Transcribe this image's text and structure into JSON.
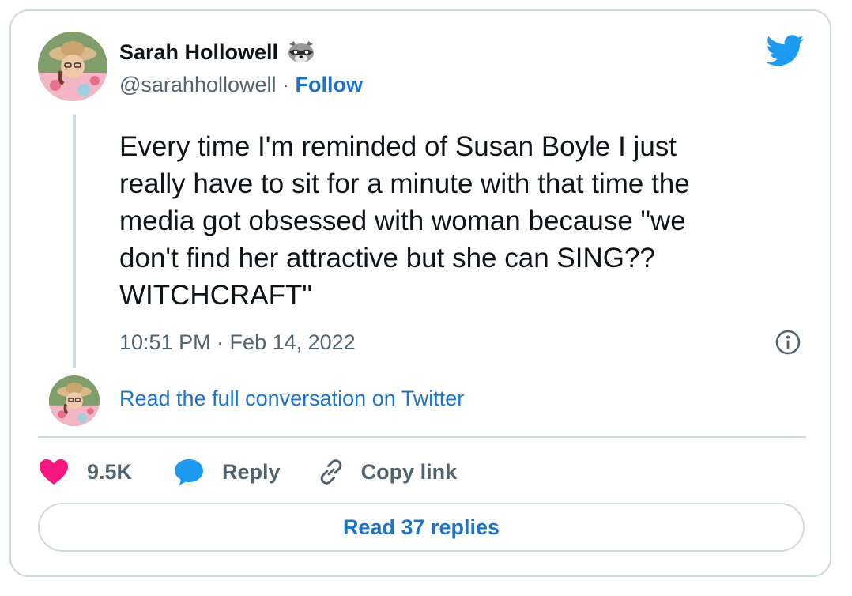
{
  "author": {
    "name": "Sarah Hollowell",
    "name_emoji": "raccoon-emoji",
    "handle": "@sarahhollowell",
    "separator": " · ",
    "follow_label": "Follow"
  },
  "tweet": {
    "text": "Every time I'm reminded of Susan Boyle I just\nreally have to sit for a minute with that time the\nmedia got obsessed with woman because \"we\ndon't find her attractive but she can SING??\nWITCHCRAFT\"",
    "timestamp": "10:51 PM · Feb 14, 2022"
  },
  "conversation": {
    "read_full_label": "Read the full conversation on Twitter"
  },
  "actions": {
    "like_count": "9.5K",
    "reply_label": "Reply",
    "copy_link_label": "Copy link"
  },
  "replies": {
    "read_replies_label": "Read 37 replies"
  },
  "icons": {
    "brand": "twitter-bird-icon",
    "info": "info-icon",
    "like": "heart-icon",
    "reply": "speech-bubble-icon",
    "copy": "link-icon"
  },
  "colors": {
    "twitter_blue": "#1d9bf0",
    "link_blue": "#1d74c9",
    "heart_pink": "#f91880",
    "muted_gray": "#536471",
    "border_gray": "#cfd9de",
    "text_dark": "#0f1419"
  }
}
